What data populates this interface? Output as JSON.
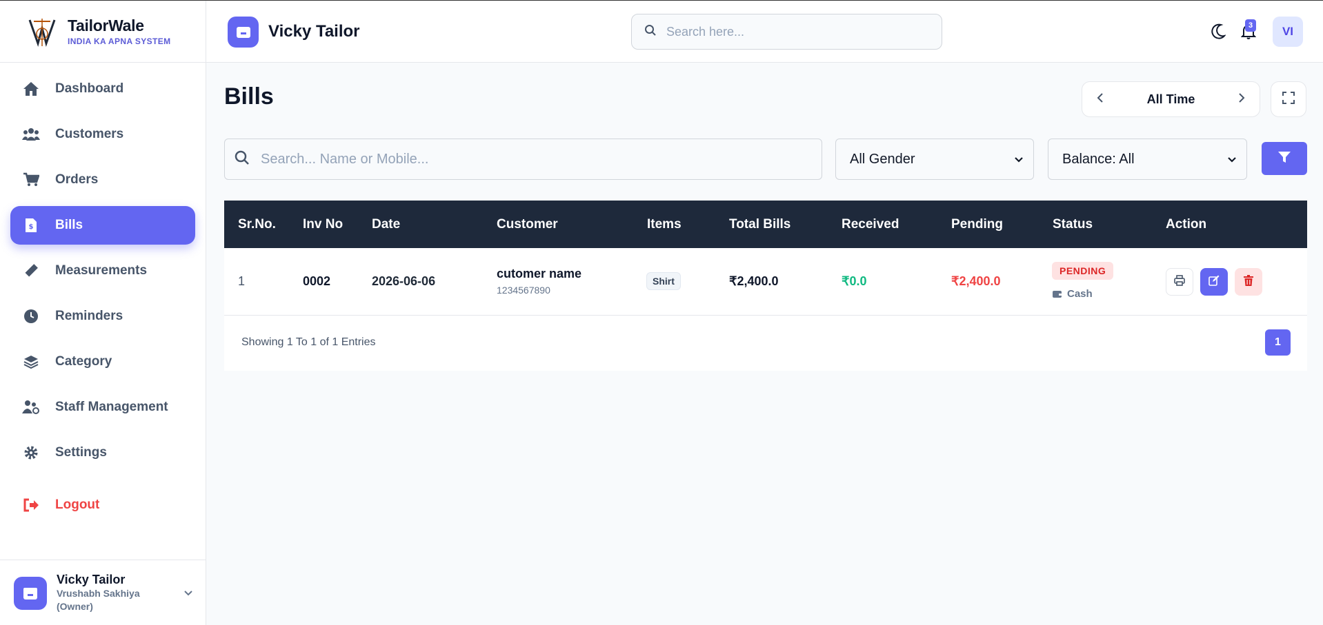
{
  "brand": {
    "name": "TailorWale",
    "tagline": "INDIA KA APNA SYSTEM"
  },
  "nav": [
    {
      "label": "Dashboard",
      "icon": "home-icon"
    },
    {
      "label": "Customers",
      "icon": "users-icon"
    },
    {
      "label": "Orders",
      "icon": "cart-icon"
    },
    {
      "label": "Bills",
      "icon": "bill-icon",
      "active": true
    },
    {
      "label": "Measurements",
      "icon": "ruler-icon"
    },
    {
      "label": "Reminders",
      "icon": "clock-icon"
    },
    {
      "label": "Category",
      "icon": "layers-icon"
    },
    {
      "label": "Staff Management",
      "icon": "staff-icon"
    },
    {
      "label": "Settings",
      "icon": "gear-icon"
    }
  ],
  "logout_label": "Logout",
  "profile": {
    "name": "Vicky Tailor",
    "sub": "Vrushabh Sakhiya (Owner)"
  },
  "header": {
    "shop_name": "Vicky Tailor",
    "search_placeholder": "Search here...",
    "notification_count": "3",
    "user_initials": "VI"
  },
  "page": {
    "title": "Bills",
    "period": "All Time",
    "search_placeholder": "Search... Name or Mobile...",
    "gender_filter": "All Gender",
    "balance_filter": "Balance: All"
  },
  "table": {
    "columns": [
      "Sr.No.",
      "Inv No",
      "Date",
      "Customer",
      "Items",
      "Total Bills",
      "Received",
      "Pending",
      "Status",
      "Action"
    ],
    "rows": [
      {
        "sr": "1",
        "inv": "0002",
        "date": "2026-06-06",
        "customer_name": "cutomer name",
        "customer_mobile": "1234567890",
        "item": "Shirt",
        "total": "₹2,400.0",
        "received": "₹0.0",
        "pending": "₹2,400.0",
        "status": "PENDING",
        "payment_mode": "Cash"
      }
    ],
    "showing": "Showing 1 To 1 of 1 Entries",
    "current_page": "1"
  },
  "colors": {
    "accent": "#6366f1",
    "header_dark": "#1e293b",
    "received": "#10b981",
    "pending": "#ef4444"
  }
}
